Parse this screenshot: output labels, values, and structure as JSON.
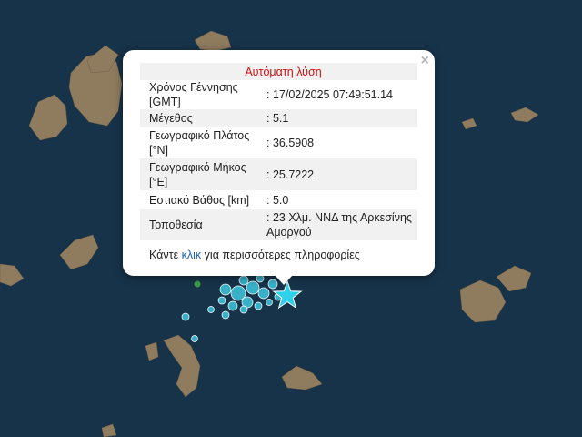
{
  "popup": {
    "title": "Αυτόματη λύση",
    "close": "×",
    "rows": [
      {
        "label": "Χρόνος Γέννησης [GMT]",
        "value": ": 17/02/2025 07:49:51.14"
      },
      {
        "label": "Μέγεθος",
        "value": ": 5.1"
      },
      {
        "label": "Γεωγραφικό Πλάτος [°N]",
        "value": ": 36.5908"
      },
      {
        "label": "Γεωγραφικό Μήκος [°E]",
        "value": ": 25.7222"
      },
      {
        "label": "Εστιακό Βάθος [km]",
        "value": ": 5.0"
      },
      {
        "label": "Τοποθεσία",
        "value": ": 23 Χλμ. ΝΝΔ της Αρκεσίνης Αμοργού"
      }
    ],
    "footer_pre": "Κάντε",
    "footer_link": "κλικ",
    "footer_post": "για περισσότερες πληροφορίες"
  },
  "colors": {
    "sea": "#17334a",
    "land": "#8f7b5e",
    "quake": "#3ec3da",
    "quake_star": "#2fd0ea",
    "old_quake": "#3f9a4a"
  },
  "icons": {
    "close": "close-icon",
    "main_event": "star-marker-icon"
  }
}
